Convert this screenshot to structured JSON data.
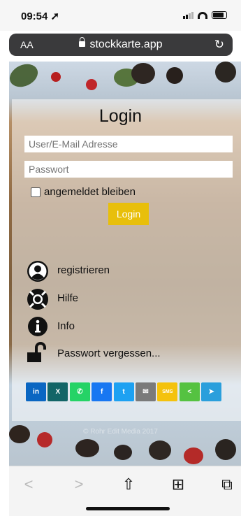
{
  "status": {
    "time": "09:54 ➚"
  },
  "url_bar": {
    "text_size_label": "AA",
    "domain": "stockkarte.app",
    "reload_icon": "reload-icon"
  },
  "login": {
    "title": "Login",
    "user_placeholder": "User/E-Mail Adresse",
    "password_placeholder": "Passwort",
    "remember_label": "angemeldet bleiben",
    "button_label": "Login"
  },
  "menu": [
    {
      "icon": "user-icon",
      "label": "registrieren"
    },
    {
      "icon": "lifebuoy-icon",
      "label": "Hilfe"
    },
    {
      "icon": "info-icon",
      "label": "Info"
    },
    {
      "icon": "unlock-icon",
      "label": "Passwort vergessen..."
    }
  ],
  "share_buttons": [
    {
      "name": "linkedin",
      "label": "in",
      "color": "#0a66c2"
    },
    {
      "name": "xing",
      "label": "X",
      "color": "#126567"
    },
    {
      "name": "whatsapp",
      "label": "✆",
      "color": "#25d366"
    },
    {
      "name": "facebook",
      "label": "f",
      "color": "#1877f2"
    },
    {
      "name": "twitter",
      "label": "t",
      "color": "#1da1f2"
    },
    {
      "name": "email",
      "label": "✉",
      "color": "#7a7a7a"
    },
    {
      "name": "sms",
      "label": "SMS",
      "color": "#f4c20d"
    },
    {
      "name": "share",
      "label": "<",
      "color": "#55c241"
    },
    {
      "name": "telegram",
      "label": "➤",
      "color": "#2a9fdc"
    }
  ],
  "footer": {
    "copyright": "© Rohr Edit Media 2017"
  },
  "toolbar": {
    "back": "<",
    "forward": ">",
    "share": "⇧",
    "bookmarks": "⊞",
    "tabs": "⧉"
  },
  "colors": {
    "login_button": "#e8bf0b",
    "url_bar": "#3a3a3c"
  }
}
